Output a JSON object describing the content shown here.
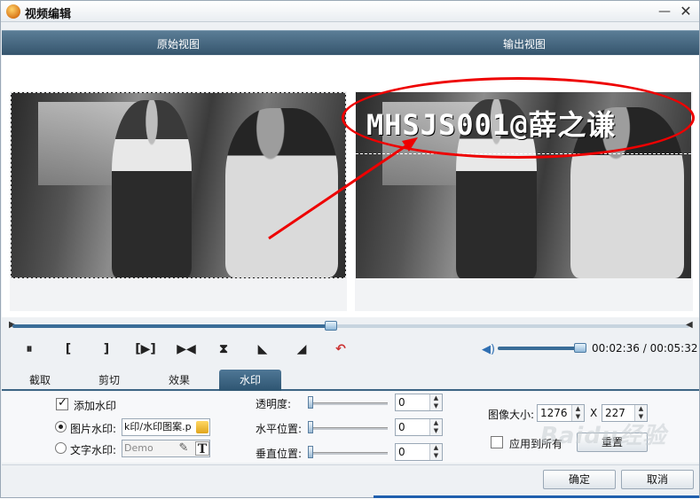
{
  "window": {
    "title": "视频编辑"
  },
  "views": {
    "original_label": "原始视图",
    "output_label": "输出视图"
  },
  "watermark_preview_text": "MHSJS001@薛之谦",
  "playback": {
    "progress": 0.47,
    "volume": 0.95,
    "current_time": "00:02:36",
    "total_time": "00:05:32",
    "time_display": "00:02:36 / 00:05:32"
  },
  "controls": {
    "pause": "⏸",
    "mark_in": "[",
    "mark_out": "]",
    "step_forward": "[▶]",
    "next_frame": "▶◀",
    "flip_vertical": "⏵",
    "flip_a": "◣",
    "flip_b": "◢",
    "undo": "↶"
  },
  "tabs": [
    {
      "label": "截取",
      "active": false
    },
    {
      "label": "剪切",
      "active": false
    },
    {
      "label": "效果",
      "active": false
    },
    {
      "label": "水印",
      "active": true
    }
  ],
  "watermark": {
    "add_label": "添加水印",
    "add_checked": true,
    "image_label": "图片水印:",
    "image_value": "k印/水印图案.p",
    "text_label": "文字水印:",
    "text_placeholder": "Demo"
  },
  "adjust": {
    "opacity_label": "透明度:",
    "opacity_value": "0",
    "hpos_label": "水平位置:",
    "hpos_value": "0",
    "vpos_label": "垂直位置:",
    "vpos_value": "0"
  },
  "image_size": {
    "label": "图像大小:",
    "width": "1276",
    "x_label": "X",
    "height": "227",
    "apply_all_label": "应用到所有",
    "reset_label": "重置"
  },
  "footer": {
    "ok_label": "确定",
    "cancel_label": "取消"
  },
  "colors": {
    "header": "#35556d",
    "accent": "#3a6d98",
    "annotation": "#ee0000"
  },
  "overlay_watermark": "Baidu经验"
}
